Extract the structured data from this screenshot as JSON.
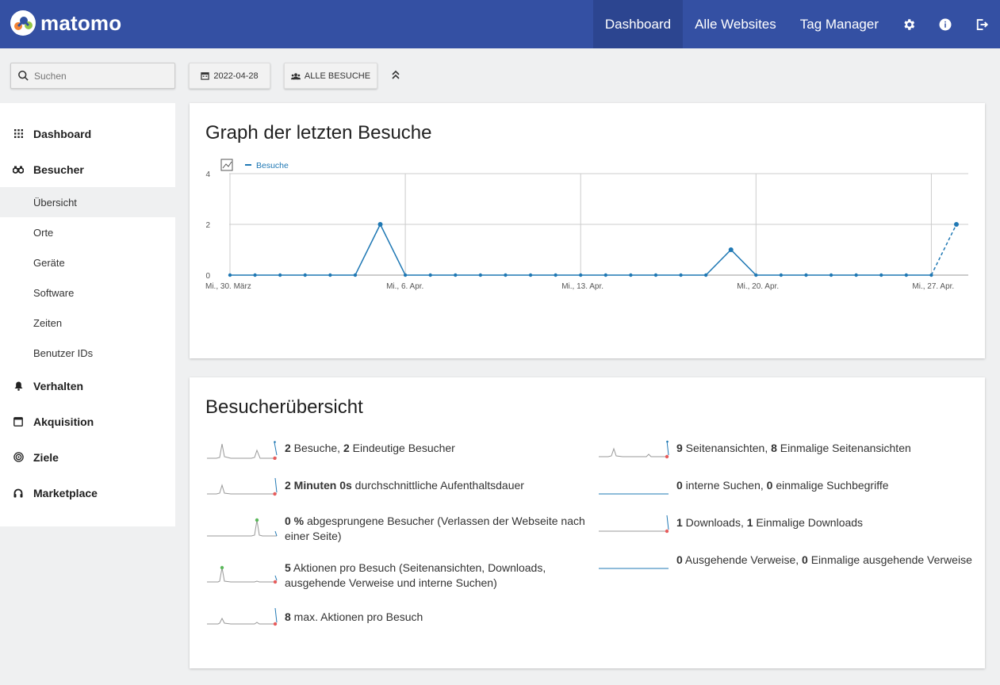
{
  "app": {
    "logo_text": "matomo"
  },
  "nav": {
    "items": [
      {
        "label": "Dashboard",
        "active": true
      },
      {
        "label": "Alle Websites"
      },
      {
        "label": "Tag Manager"
      }
    ],
    "icons": [
      "gear-icon",
      "info-icon",
      "logout-icon"
    ]
  },
  "search": {
    "placeholder": "Suchen"
  },
  "controls": {
    "date": "2022-04-28",
    "segment": "ALLE BESUCHE"
  },
  "sidebar": {
    "sections": [
      {
        "label": "Dashboard",
        "icon": "grid-icon"
      },
      {
        "label": "Besucher",
        "icon": "binoculars-icon"
      },
      {
        "label": "Verhalten",
        "icon": "bell-icon"
      },
      {
        "label": "Akquisition",
        "icon": "window-icon"
      },
      {
        "label": "Ziele",
        "icon": "target-icon"
      },
      {
        "label": "Marketplace",
        "icon": "headphones-icon"
      }
    ],
    "visitor_items": [
      "Übersicht",
      "Orte",
      "Geräte",
      "Software",
      "Zeiten",
      "Benutzer IDs"
    ]
  },
  "graph": {
    "title": "Graph der letzten Besuche",
    "legend": "Besuche",
    "line_color": "#1f78b4"
  },
  "chart_data": {
    "type": "line",
    "title": "Graph der letzten Besuche",
    "ylim": [
      0,
      4
    ],
    "yticks": [
      0,
      2,
      4
    ],
    "xtick_labels": [
      "Mi., 30. März",
      "Mi., 6. Apr.",
      "Mi., 13. Apr.",
      "Mi., 20. Apr.",
      "Mi., 27. Apr."
    ],
    "x": [
      "2022-03-30",
      "2022-03-31",
      "2022-04-01",
      "2022-04-02",
      "2022-04-03",
      "2022-04-04",
      "2022-04-05",
      "2022-04-06",
      "2022-04-07",
      "2022-04-08",
      "2022-04-09",
      "2022-04-10",
      "2022-04-11",
      "2022-04-12",
      "2022-04-13",
      "2022-04-14",
      "2022-04-15",
      "2022-04-16",
      "2022-04-17",
      "2022-04-18",
      "2022-04-19",
      "2022-04-20",
      "2022-04-21",
      "2022-04-22",
      "2022-04-23",
      "2022-04-24",
      "2022-04-25",
      "2022-04-26",
      "2022-04-27",
      "2022-04-28"
    ],
    "series": [
      {
        "name": "Besuche",
        "values": [
          0,
          0,
          0,
          0,
          0,
          0,
          2,
          0,
          0,
          0,
          0,
          0,
          0,
          0,
          0,
          0,
          0,
          0,
          0,
          0,
          1,
          0,
          0,
          0,
          0,
          0,
          0,
          0,
          0,
          2
        ]
      }
    ],
    "grid": true,
    "legend_position": "top-left"
  },
  "overview": {
    "title": "Besucherübersicht",
    "left": [
      {
        "n1": "2",
        "t1": " Besuche, ",
        "n2": "2",
        "t2": " Eindeutige Besucher"
      },
      {
        "n1": "2 Minuten 0s",
        "t1": " durchschnittliche Aufenthaltsdauer"
      },
      {
        "n1": "0 %",
        "t1": " abgesprungene Besucher (Verlassen der Webseite nach einer Seite)"
      },
      {
        "n1": "5",
        "t1": " Aktionen pro Besuch (Seitenansichten, Downloads, ausgehende Verweise und interne Suchen)"
      },
      {
        "n1": "8",
        "t1": " max. Aktionen pro Besuch"
      }
    ],
    "right": [
      {
        "n1": "9",
        "t1": " Seitenansichten, ",
        "n2": "8",
        "t2": " Einmalige Seitenansichten"
      },
      {
        "n1": "0",
        "t1": " interne Suchen, ",
        "n2": "0",
        "t2": " einmalige Suchbegriffe"
      },
      {
        "n1": "1",
        "t1": " Downloads, ",
        "n2": "1",
        "t2": " Einmalige Downloads"
      },
      {
        "n1": "0",
        "t1": " Ausgehende Verweise, ",
        "n2": "0",
        "t2": " Einmalige ausgehende Verweise"
      }
    ]
  }
}
